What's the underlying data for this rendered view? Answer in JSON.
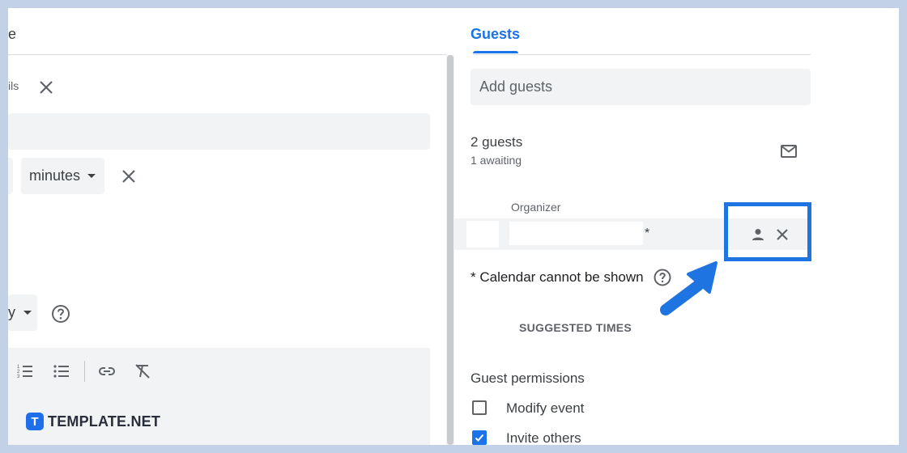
{
  "left": {
    "tab_partial": "e",
    "notification_partial": "ils",
    "unit_select": "minutes",
    "visibility_partial": "y",
    "toolbar_icons": [
      "numbered-list-icon",
      "bulleted-list-icon",
      "link-icon",
      "clear-formatting-icon"
    ]
  },
  "logo": {
    "badge": "T",
    "text": "TEMPLATE.NET"
  },
  "right": {
    "tab_label": "Guests",
    "add_guests_placeholder": "Add guests",
    "guest_count": "2 guests",
    "awaiting": "1 awaiting",
    "organizer_label": "Organizer",
    "asterisk": "*",
    "calendar_note": "* Calendar cannot be shown",
    "suggested_times": "SUGGESTED TIMES",
    "permissions_title": "Guest permissions",
    "permissions": [
      {
        "label": "Modify event",
        "checked": false
      },
      {
        "label": "Invite others",
        "checked": true
      }
    ]
  },
  "colors": {
    "accent": "#1a73e8",
    "highlight": "#1e74e0",
    "backdrop": "#c3d1e6"
  }
}
